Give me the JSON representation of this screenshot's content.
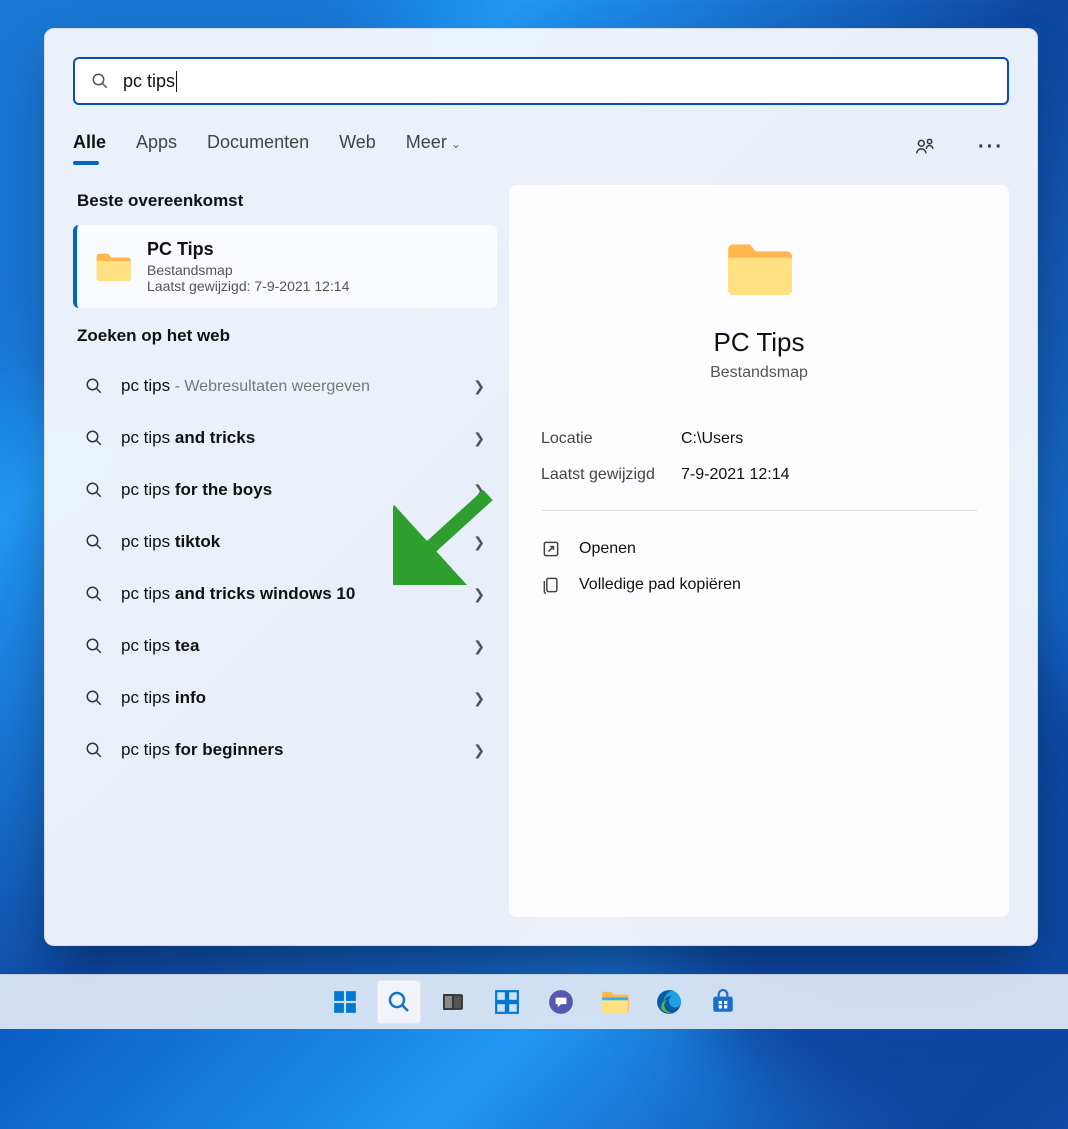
{
  "search": {
    "query": "pc tips"
  },
  "tabs": {
    "items": [
      "Alle",
      "Apps",
      "Documenten",
      "Web",
      "Meer"
    ],
    "active_index": 0
  },
  "sections": {
    "best_match": "Beste overeenkomst",
    "web_search": "Zoeken op het web"
  },
  "best_match": {
    "title": "PC Tips",
    "type": "Bestandsmap",
    "modified_label": "Laatst gewijzigd: 7-9-2021 12:14"
  },
  "web_results": [
    {
      "prefix": "pc tips",
      "bold": "",
      "suffix": " - Webresultaten weergeven"
    },
    {
      "prefix": "pc tips ",
      "bold": "and tricks",
      "suffix": ""
    },
    {
      "prefix": "pc tips ",
      "bold": "for the boys",
      "suffix": ""
    },
    {
      "prefix": "pc tips ",
      "bold": "tiktok",
      "suffix": ""
    },
    {
      "prefix": "pc tips ",
      "bold": "and tricks windows 10",
      "suffix": ""
    },
    {
      "prefix": "pc tips ",
      "bold": "tea",
      "suffix": ""
    },
    {
      "prefix": "pc tips ",
      "bold": "info",
      "suffix": ""
    },
    {
      "prefix": "pc tips ",
      "bold": "for beginners",
      "suffix": ""
    }
  ],
  "detail": {
    "title": "PC Tips",
    "type": "Bestandsmap",
    "meta": {
      "location_label": "Locatie",
      "location_value": "C:\\Users",
      "modified_label": "Laatst gewijzigd",
      "modified_value": "7-9-2021 12:14"
    },
    "actions": {
      "open": "Openen",
      "copy_path": "Volledige pad kopiëren"
    }
  },
  "taskbar": {
    "items": [
      "start",
      "search",
      "task-view",
      "widgets",
      "chat",
      "file-explorer",
      "edge",
      "store"
    ],
    "active": "search"
  }
}
